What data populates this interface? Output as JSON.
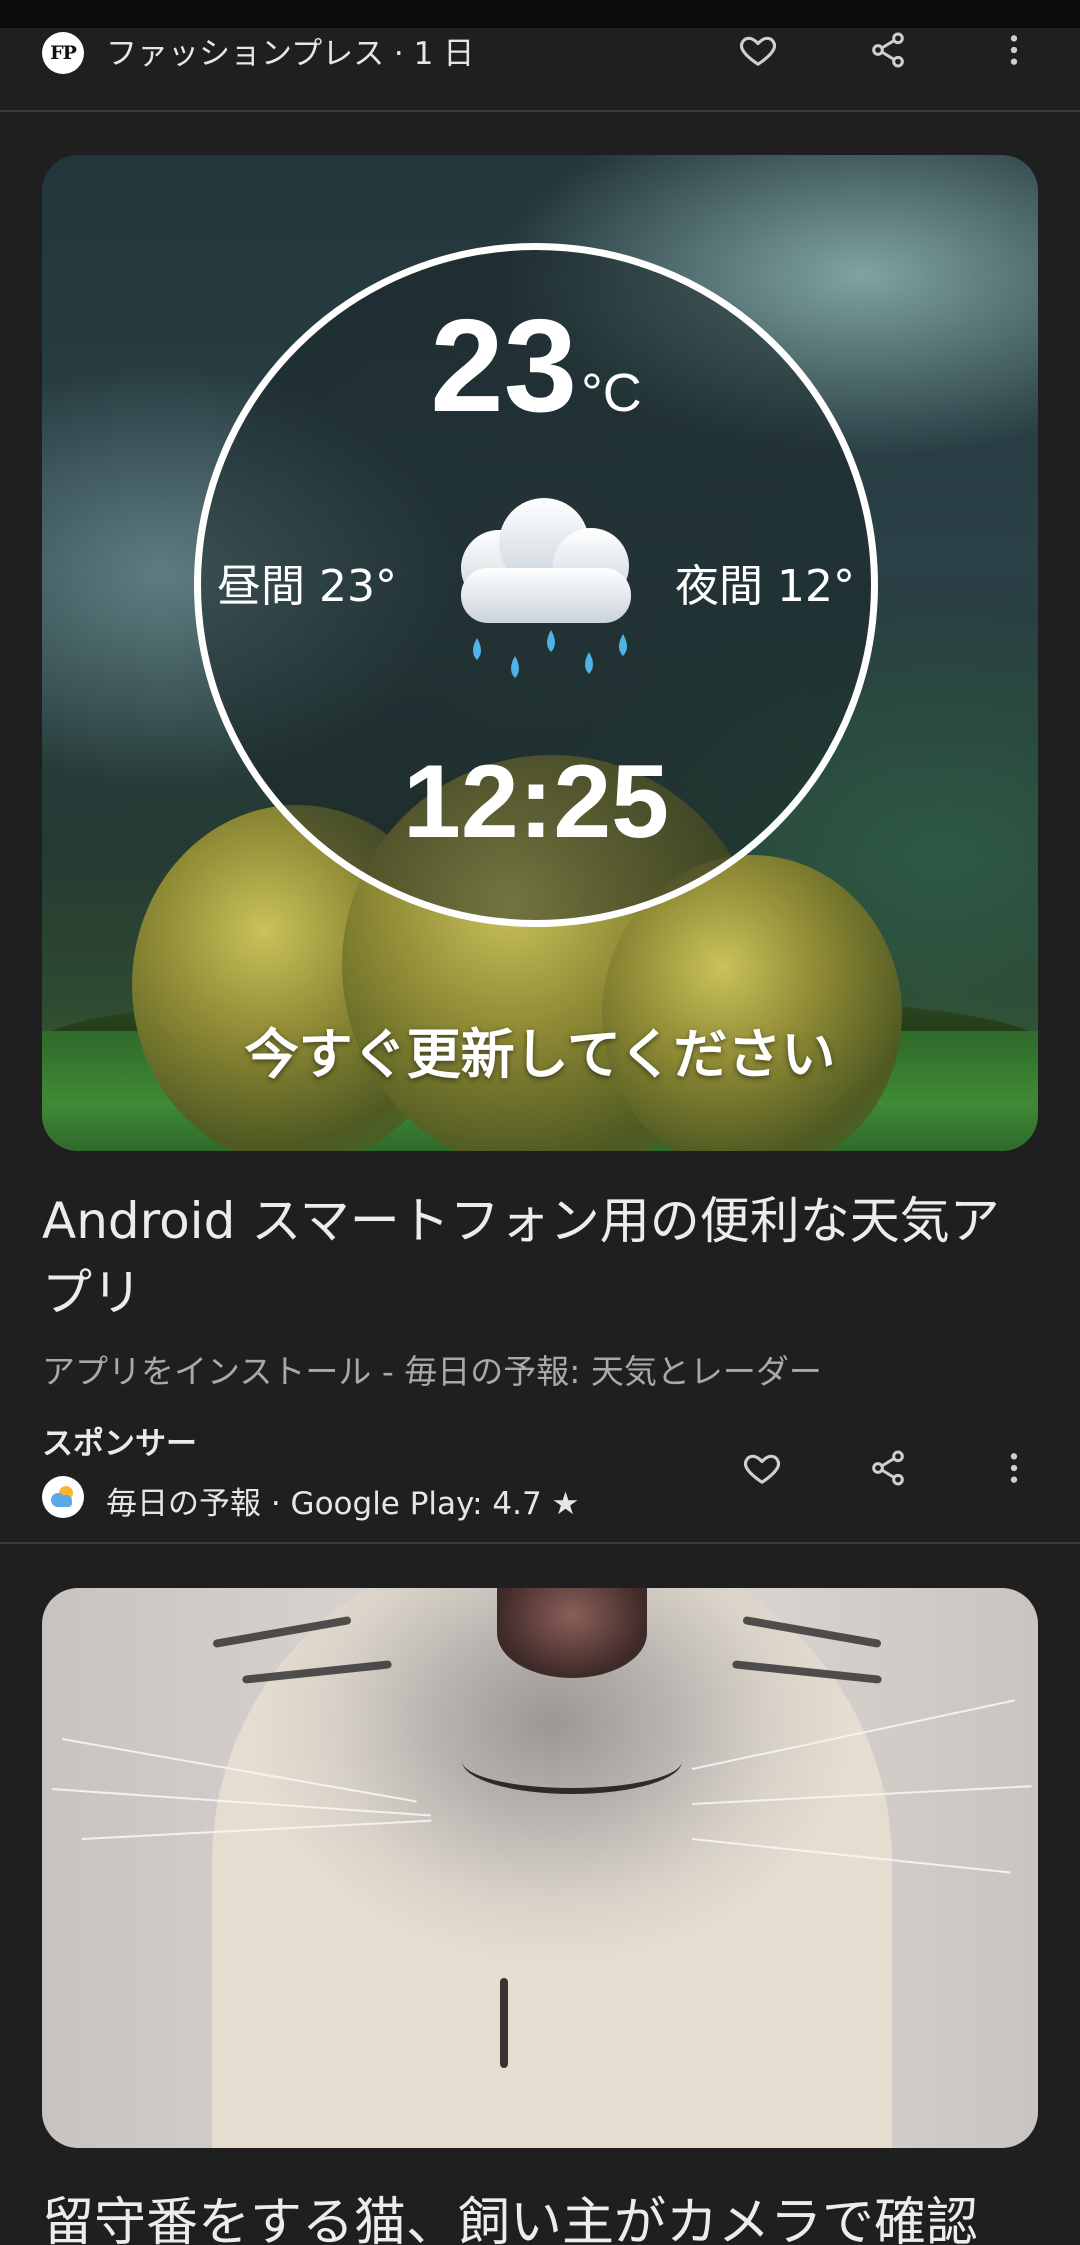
{
  "article": {
    "source_logo_text": "FP",
    "source_line": "ファッションプレス · 1 日"
  },
  "ad": {
    "image": {
      "temp": "23",
      "temp_unit": "°C",
      "day_label": "昼間 23°",
      "night_label": "夜間 12°",
      "time": "12:25",
      "cta_text": "今すぐ更新してください",
      "weather_icon": "cloud-rain-icon"
    },
    "title": "Android スマートフォン用の便利な天気アプリ",
    "subtitle": "アプリをインストール - 毎日の予報: 天気とレーダー",
    "sponsor_label": "スポンサー",
    "app_info": "毎日の予報 · Google Play: 4.7 ★"
  },
  "next_article": {
    "title": "留守番をする猫、飼い主がカメラで確認"
  },
  "icons": {
    "like": "heart-icon",
    "share": "share-icon",
    "more": "more-vert-icon"
  },
  "colors": {
    "background": "#1f1f1f",
    "divider": "#3a3a3a",
    "text_primary": "#ececec",
    "text_secondary": "#a9a9a9"
  }
}
